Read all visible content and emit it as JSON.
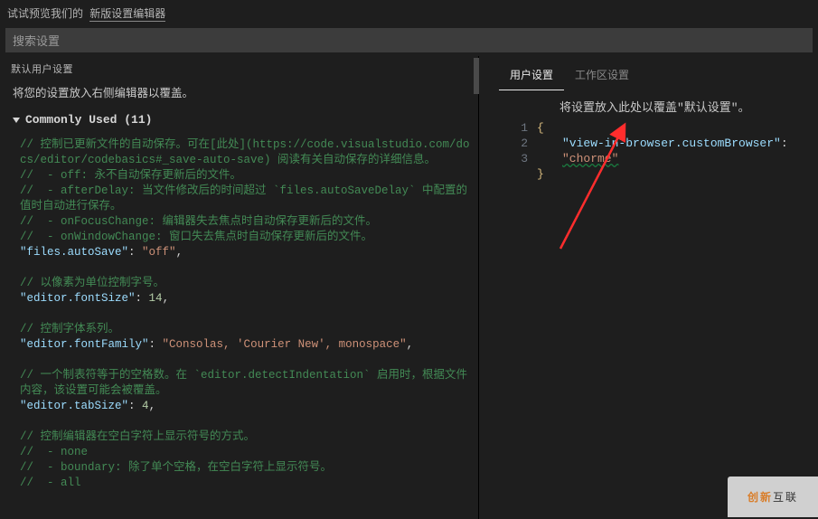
{
  "topbar": {
    "preview_text": "试试预览我们的",
    "link_label": "新版设置编辑器"
  },
  "search": {
    "placeholder": "搜索设置"
  },
  "left": {
    "header": "默认用户设置",
    "subtitle": "将您的设置放入右侧编辑器以覆盖。",
    "group_header": "Commonly Used (11)",
    "lines": [
      {
        "t": "comment",
        "v": "// 控制已更新文件的自动保存。可在[此处](https://code.visualstudio.com/docs/editor/codebasics#_save-auto-save) 阅读有关自动保存的详细信息。"
      },
      {
        "t": "comment",
        "v": "//  - off: 永不自动保存更新后的文件。"
      },
      {
        "t": "comment",
        "v": "//  - afterDelay: 当文件修改后的时间超过 `files.autoSaveDelay` 中配置的值时自动进行保存。"
      },
      {
        "t": "comment",
        "v": "//  - onFocusChange: 编辑器失去焦点时自动保存更新后的文件。"
      },
      {
        "t": "comment",
        "v": "//  - onWindowChange: 窗口失去焦点时自动保存更新后的文件。"
      },
      {
        "t": "kv",
        "k": "files.autoSave",
        "v": "\"off\"",
        "trail": ","
      },
      {
        "t": "blank"
      },
      {
        "t": "comment",
        "v": "// 以像素为单位控制字号。"
      },
      {
        "t": "kv",
        "k": "editor.fontSize",
        "v": "14",
        "num": true,
        "trail": ","
      },
      {
        "t": "blank"
      },
      {
        "t": "comment",
        "v": "// 控制字体系列。"
      },
      {
        "t": "kv",
        "k": "editor.fontFamily",
        "v": "\"Consolas, 'Courier New', monospace\"",
        "trail": ","
      },
      {
        "t": "blank"
      },
      {
        "t": "comment",
        "v": "// 一个制表符等于的空格数。在 `editor.detectIndentation` 启用时，根据文件内容，该设置可能会被覆盖。"
      },
      {
        "t": "kv",
        "k": "editor.tabSize",
        "v": "4",
        "num": true,
        "trail": ","
      },
      {
        "t": "blank"
      },
      {
        "t": "comment",
        "v": "// 控制编辑器在空白字符上显示符号的方式。"
      },
      {
        "t": "comment",
        "v": "//  - none"
      },
      {
        "t": "comment",
        "v": "//  - boundary: 除了单个空格，在空白字符上显示符号。"
      },
      {
        "t": "comment",
        "v": "//  - all"
      }
    ]
  },
  "right": {
    "tabs": {
      "user": "用户设置",
      "workspace": "工作区设置"
    },
    "subtitle": "将设置放入此处以覆盖\"默认设置\"。",
    "lines": {
      "n1": "1",
      "n2": "2",
      "n3": "3",
      "open": "{",
      "key": "\"view-in-browser.customBrowser\"",
      "colon": ": ",
      "val": "\"chorme\"",
      "close": "}"
    }
  },
  "watermark": {
    "a": "创新",
    "b": "互联"
  }
}
